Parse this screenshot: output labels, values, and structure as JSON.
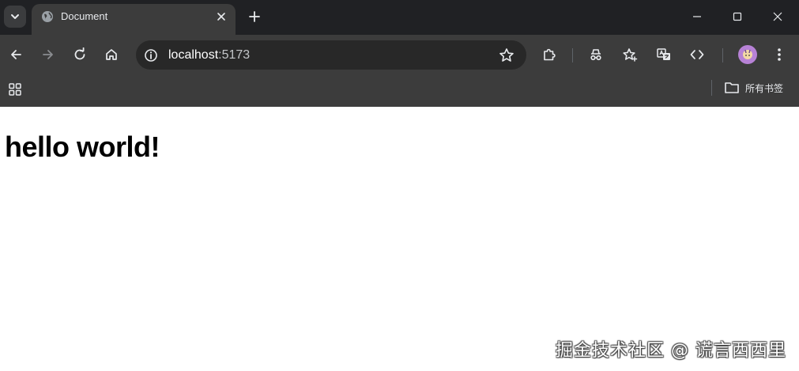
{
  "tab": {
    "title": "Document",
    "favicon": "globe-icon"
  },
  "toolbar": {
    "url_host": "localhost",
    "url_port": ":5173"
  },
  "bookmarks_bar": {
    "all_bookmarks_label": "所有书签"
  },
  "page": {
    "heading": "hello world!"
  },
  "watermark": {
    "text": "掘金技术社区 @ 谎言西西里"
  },
  "colors": {
    "tabstrip_bg": "#202124",
    "toolbar_bg": "#3c3c3c",
    "omnibox_bg": "#282828",
    "avatar_bg": "#b782d6"
  }
}
